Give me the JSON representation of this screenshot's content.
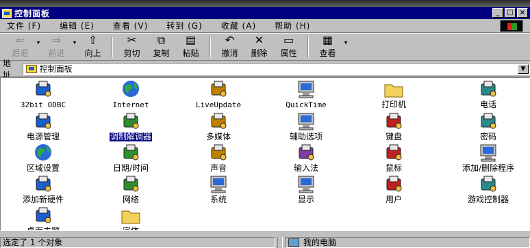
{
  "window": {
    "title": "控制面板"
  },
  "menu": [
    "文件 (F)",
    "编辑 (E)",
    "查看 (V)",
    "转到 (G)",
    "收藏 (A)",
    "帮助 (H)"
  ],
  "toolbar": {
    "back": "后退",
    "forward": "前进",
    "up": "向上",
    "cut": "剪切",
    "copy": "复制",
    "paste": "粘贴",
    "undo": "撤消",
    "delete": "删除",
    "properties": "属性",
    "views": "查看"
  },
  "address": {
    "label": "地址",
    "value": "控制面板"
  },
  "items": [
    {
      "label": "32bit ODBC",
      "icon": "odbc-icon"
    },
    {
      "label": "Internet",
      "icon": "internet-icon"
    },
    {
      "label": "LiveUpdate",
      "icon": "liveupdate-icon"
    },
    {
      "label": "QuickTime",
      "icon": "quicktime-icon"
    },
    {
      "label": "打印机",
      "icon": "printer-folder-icon"
    },
    {
      "label": "电话",
      "icon": "telephony-icon"
    },
    {
      "label": "电源管理",
      "icon": "power-icon"
    },
    {
      "label": "调制解调器",
      "icon": "modem-icon"
    },
    {
      "label": "多媒体",
      "icon": "multimedia-icon"
    },
    {
      "label": "辅助选项",
      "icon": "accessibility-icon"
    },
    {
      "label": "键盘",
      "icon": "keyboard-icon"
    },
    {
      "label": "密码",
      "icon": "password-keys-icon"
    },
    {
      "label": "区域设置",
      "icon": "globe-icon"
    },
    {
      "label": "日期/时间",
      "icon": "calendar-clock-icon"
    },
    {
      "label": "声音",
      "icon": "speaker-icon"
    },
    {
      "label": "输入法",
      "icon": "input-method-icon"
    },
    {
      "label": "鼠标",
      "icon": "mouse-icon"
    },
    {
      "label": "添加/删除程序",
      "icon": "add-remove-programs-icon"
    },
    {
      "label": "添加新硬件",
      "icon": "add-hardware-icon"
    },
    {
      "label": "网络",
      "icon": "network-icon"
    },
    {
      "label": "系统",
      "icon": "system-computer-icon"
    },
    {
      "label": "显示",
      "icon": "display-icon"
    },
    {
      "label": "用户",
      "icon": "users-icon"
    },
    {
      "label": "游戏控制器",
      "icon": "game-controller-icon"
    },
    {
      "label": "桌面主题",
      "icon": "desktop-themes-icon"
    },
    {
      "label": "字体",
      "icon": "fonts-folder-icon"
    }
  ],
  "status": {
    "left": "选定了 1 个对象",
    "right": "我的电脑"
  },
  "colors": {
    "titlebar": "#000080",
    "face": "#c0c0c0",
    "selection": "#000080"
  }
}
